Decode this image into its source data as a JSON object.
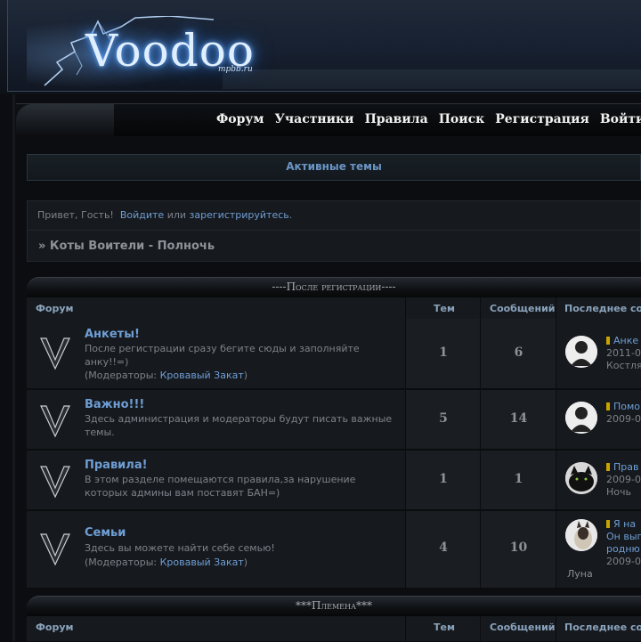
{
  "header": {
    "logo_text": "Voodoo",
    "logo_sub": "mpbb.ru"
  },
  "nav": {
    "items": [
      {
        "label": "Форум"
      },
      {
        "label": "Участники"
      },
      {
        "label": "Правила"
      },
      {
        "label": "Поиск"
      },
      {
        "label": "Регистрация"
      },
      {
        "label": "Войти"
      }
    ]
  },
  "active_topics": "Активные темы",
  "greeting": {
    "prefix": "Привет, Гость!",
    "login": "Войдите",
    "or": "или",
    "register": "зарегистрируйтесь",
    "dot": "."
  },
  "breadcrumb": "» Коты Воители - Полночь",
  "categories": [
    {
      "title": "----После регистрации----",
      "columns": {
        "forum": "Форум",
        "topics": "Тем",
        "posts": "Сообщений",
        "last": "Последнее соо"
      },
      "forums": [
        {
          "title": "Анкеты!",
          "desc": "После регистрации сразу бегите сюды и заполняйте анку!!=)",
          "mods_prefix": "(Модераторы:",
          "mods_name": "Кровавый Закат",
          "mods_suffix": ")",
          "topics": "1",
          "posts": "6",
          "last": {
            "line1": "Анке",
            "line2": "2011-0",
            "line3": "Костля"
          }
        },
        {
          "title": "Важно!!!",
          "desc": "Здесь администрация и модераторы будут писать важные темы.",
          "topics": "5",
          "posts": "14",
          "last": {
            "line1": "Помо",
            "line2": "2009-0"
          }
        },
        {
          "title": "Правила!",
          "desc": "В этом разделе помещаются правила,за нарушение которых админы вам поставят БАН=)",
          "topics": "1",
          "posts": "1",
          "last": {
            "line1": "Прав",
            "line2": "2009-0",
            "line3": "Ночь"
          }
        },
        {
          "title": "Семьи",
          "desc": "Здесь вы можете найти себе семью!",
          "mods_prefix": "(Модераторы:",
          "mods_name": "Кровавый Закат",
          "mods_suffix": ")",
          "topics": "4",
          "posts": "10",
          "last": {
            "line1": "Я на",
            "line2": "Он вып",
            "line3": "родню",
            "line4": "2009-0",
            "line5": "Луна"
          }
        }
      ]
    },
    {
      "title": "***Племена***",
      "columns": {
        "forum": "Форум",
        "topics": "Тем",
        "posts": "Сообщений",
        "last": "Последнее соо"
      }
    }
  ]
}
